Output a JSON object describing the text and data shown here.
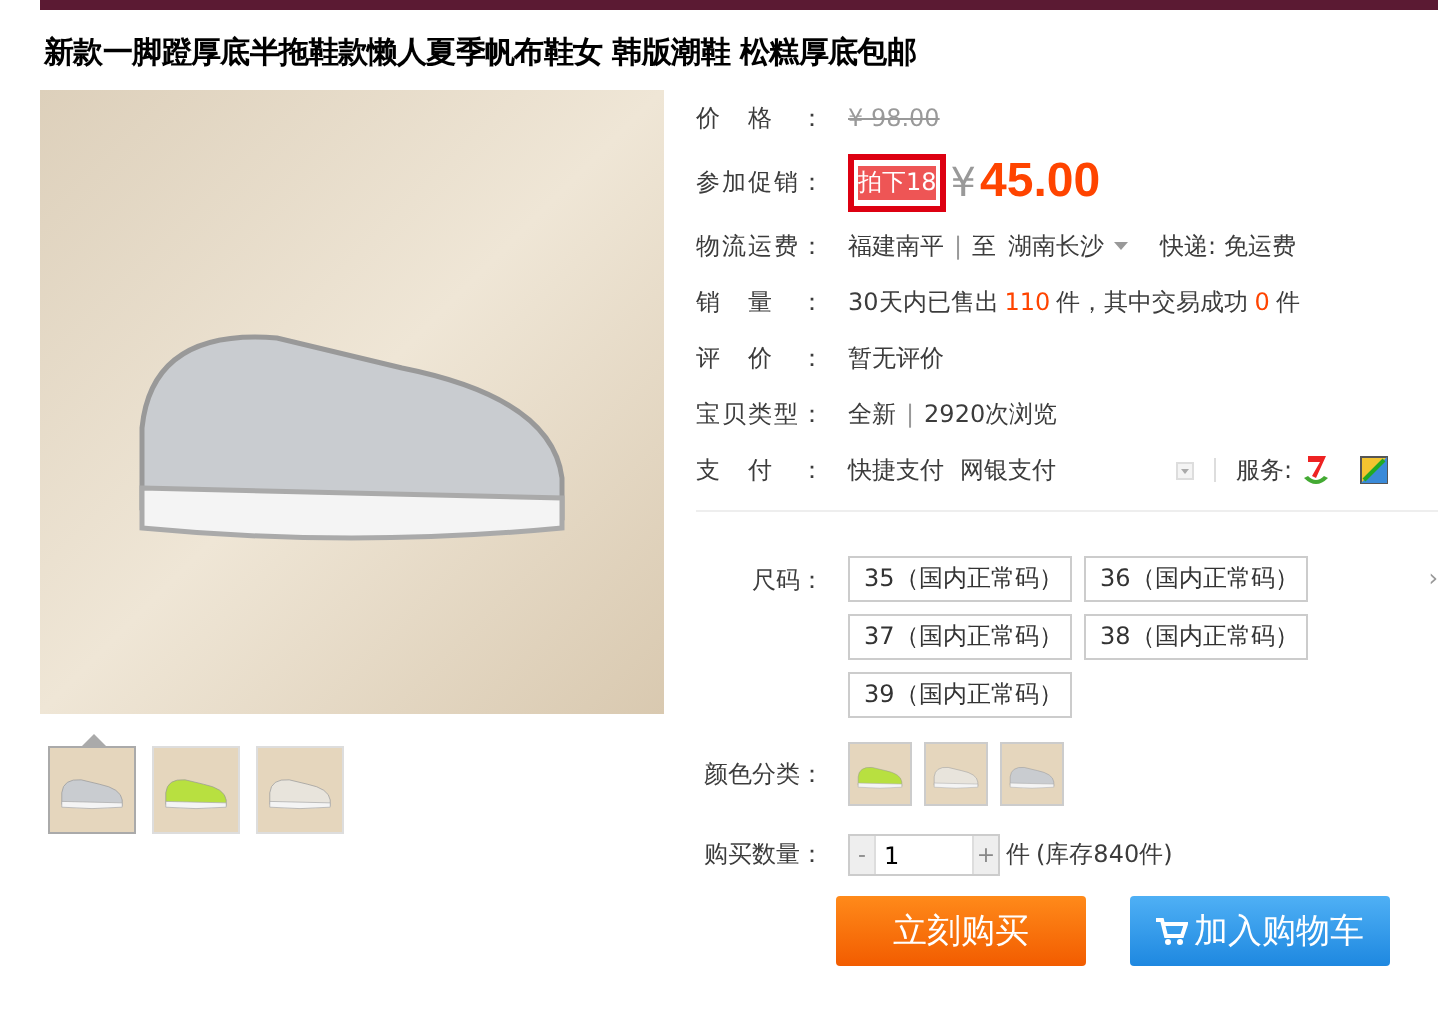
{
  "title": "新款一脚蹬厚底半拖鞋款懒人夏季帆布鞋女 韩版潮鞋 松糕厚底包邮",
  "thumbnails": [
    {
      "selected": true
    },
    {
      "selected": false
    },
    {
      "selected": false
    }
  ],
  "price": {
    "label": "价格：",
    "value": "¥ 98.00"
  },
  "promotion": {
    "label": "参加促销：",
    "tag": "拍下18",
    "highlighted": true,
    "currency": "¥",
    "amount": "45.00"
  },
  "shipping": {
    "label": "物流运费：",
    "origin": "福建南平",
    "separator": "|",
    "to": "至",
    "destination": "湖南长沙",
    "method": "快递: 免运费"
  },
  "sales": {
    "label": "销量：",
    "segments": [
      {
        "text": "30天内已售出",
        "highlight": false
      },
      {
        "text": "110",
        "highlight": true
      },
      {
        "text": "件，其中交易成功",
        "highlight": false
      },
      {
        "text": "0",
        "highlight": true
      },
      {
        "text": "件",
        "highlight": false
      }
    ]
  },
  "rating": {
    "label": "评价：",
    "value": "暂无评价"
  },
  "item_type": {
    "label": "宝贝类型：",
    "condition": "全新",
    "separator": "|",
    "views": "2920次浏览"
  },
  "payment": {
    "label": "支付：",
    "methods": [
      "快捷支付",
      "网银支付"
    ],
    "service_label": "服务:"
  },
  "sizes": {
    "label": "尺码：",
    "more": "›",
    "options": [
      {
        "text": "35（国内正常码）",
        "selected": false
      },
      {
        "text": "36（国内正常码）",
        "selected": false
      },
      {
        "text": "37（国内正常码）",
        "selected": false
      },
      {
        "text": "38（国内正常码）",
        "selected": false
      },
      {
        "text": "39（国内正常码）",
        "selected": false
      }
    ]
  },
  "colors": {
    "label": "颜色分类：",
    "options": [
      {
        "selected": false
      },
      {
        "selected": false
      },
      {
        "selected": false
      }
    ]
  },
  "quantity": {
    "label": "购买数量：",
    "minus": "-",
    "value": "1",
    "plus": "+",
    "unit": "件",
    "stock": "(库存840件)"
  },
  "buttons": {
    "buy_now": "立刻购买",
    "add_to_cart": "加入购物车"
  }
}
